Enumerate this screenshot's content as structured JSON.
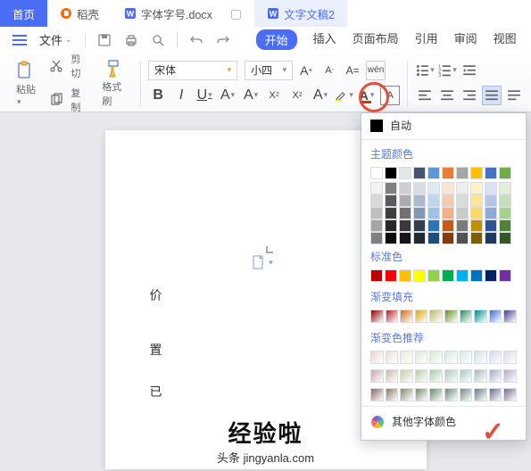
{
  "tabs": {
    "home": "首页",
    "daoke": "稻壳",
    "doc": "字体字号.docx",
    "active": "文字文稿2"
  },
  "menu": {
    "file": "文件"
  },
  "ribbon": {
    "start": "开始",
    "insert": "插入",
    "layout": "页面布局",
    "reference": "引用",
    "review": "审阅",
    "view": "视图"
  },
  "clipboard": {
    "cut": "剪切",
    "copy": "复制",
    "paste": "粘贴",
    "format_painter": "格式刷"
  },
  "font": {
    "name": "宋体",
    "size": "小四"
  },
  "dropdown": {
    "auto": "自动",
    "theme": "主题颜色",
    "standard": "标准色",
    "gradient": "渐变填充",
    "gradient_rec": "渐变色推荐",
    "other": "其他字体颜色"
  },
  "body": {
    "l1": "价",
    "l2": "置",
    "l3": "已"
  },
  "overlay": {
    "brand": "经验啦",
    "url": "jingyanla.com",
    "sub": "头条"
  },
  "chart_data": {
    "type": "palette",
    "theme_row1": [
      "#ffffff",
      "#000000",
      "#e7e6e6",
      "#44546a",
      "#5b9bd5",
      "#ed7d31",
      "#a5a5a5",
      "#ffc000",
      "#4472c4",
      "#70ad47"
    ],
    "theme_shades": [
      [
        "#f2f2f2",
        "#7f7f7f",
        "#d0cece",
        "#d6dce4",
        "#deebf6",
        "#fbe5d5",
        "#ededed",
        "#fff2cc",
        "#d9e2f3",
        "#e2efd9"
      ],
      [
        "#d8d8d8",
        "#595959",
        "#aeabab",
        "#adb9ca",
        "#bdd7ee",
        "#f7cbac",
        "#dbdbdb",
        "#fee599",
        "#b4c6e7",
        "#c5e0b3"
      ],
      [
        "#bfbfbf",
        "#3f3f3f",
        "#757070",
        "#8496b0",
        "#9cc3e5",
        "#f4b183",
        "#c9c9c9",
        "#ffd965",
        "#8eaadb",
        "#a8d08d"
      ],
      [
        "#a5a5a5",
        "#262626",
        "#3a3838",
        "#323f4f",
        "#2e75b5",
        "#c55a11",
        "#7b7b7b",
        "#bf9000",
        "#2f5496",
        "#538135"
      ],
      [
        "#7f7f7f",
        "#0c0c0c",
        "#171616",
        "#222a35",
        "#1e4e79",
        "#833c0b",
        "#525252",
        "#7f6000",
        "#1f3864",
        "#375623"
      ]
    ],
    "standard": [
      "#c00000",
      "#ff0000",
      "#ffc000",
      "#ffff00",
      "#92d050",
      "#00b050",
      "#00b0f0",
      "#0070c0",
      "#002060",
      "#7030a0"
    ],
    "gradient_fill": [
      "#8b0000",
      "#b22222",
      "#d2691e",
      "#daa520",
      "#bdb76b",
      "#6b8e23",
      "#2e8b57",
      "#008b8b",
      "#4169e1",
      "#483d8b"
    ],
    "gradient_rec": [
      [
        "#e8d5d5",
        "#e8dfd5",
        "#e8e8d5",
        "#dfe8d5",
        "#d5e8d5",
        "#d5e8df",
        "#d5e8e8",
        "#d5dfe8",
        "#d5d5e8",
        "#dfd5e8"
      ],
      [
        "#c9a8a8",
        "#c9b8a8",
        "#c9c9a8",
        "#b8c9a8",
        "#a8c9a8",
        "#a8c9b8",
        "#a8c9c9",
        "#a8b8c9",
        "#a8a8c9",
        "#b8a8c9"
      ],
      [
        "#8a6a6a",
        "#8a7a6a",
        "#8a8a6a",
        "#7a8a6a",
        "#6a8a6a",
        "#6a8a7a",
        "#6a8a8a",
        "#6a7a8a",
        "#6a6a8a",
        "#7a6a8a"
      ]
    ]
  }
}
